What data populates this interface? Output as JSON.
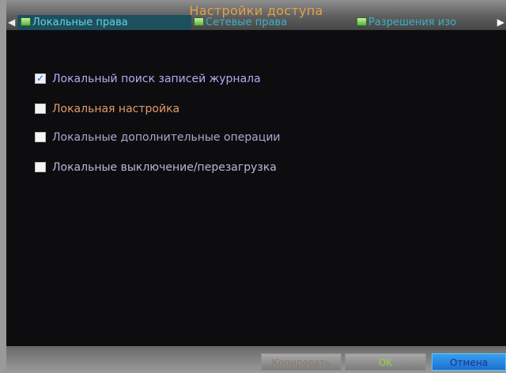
{
  "window": {
    "title": "Настройки доступа"
  },
  "tabs": {
    "prev_arrow": "◀",
    "next_arrow": "▶",
    "items": [
      {
        "label": "Локальные права",
        "active": true
      },
      {
        "label": "Сетевые права",
        "active": false
      },
      {
        "label": "Разрешения изо",
        "active": false
      }
    ]
  },
  "options": [
    {
      "label": "Локальный поиск записей журнала",
      "checked": true
    },
    {
      "label": "Локальная настройка",
      "checked": false
    },
    {
      "label": "Локальные дополнительные операции",
      "checked": false
    },
    {
      "label": "Локальные выключение/перезагрузка",
      "checked": false
    }
  ],
  "footer": {
    "copy_label": "Копировать",
    "ok_label": "OK",
    "cancel_label": "Отмена"
  },
  "colors": {
    "accent_title": "#e2a24a",
    "tab_active_bg": "#1d4f5e",
    "tab_text": "#3ab0c4",
    "cancel_bg": "#1c6fd0"
  }
}
